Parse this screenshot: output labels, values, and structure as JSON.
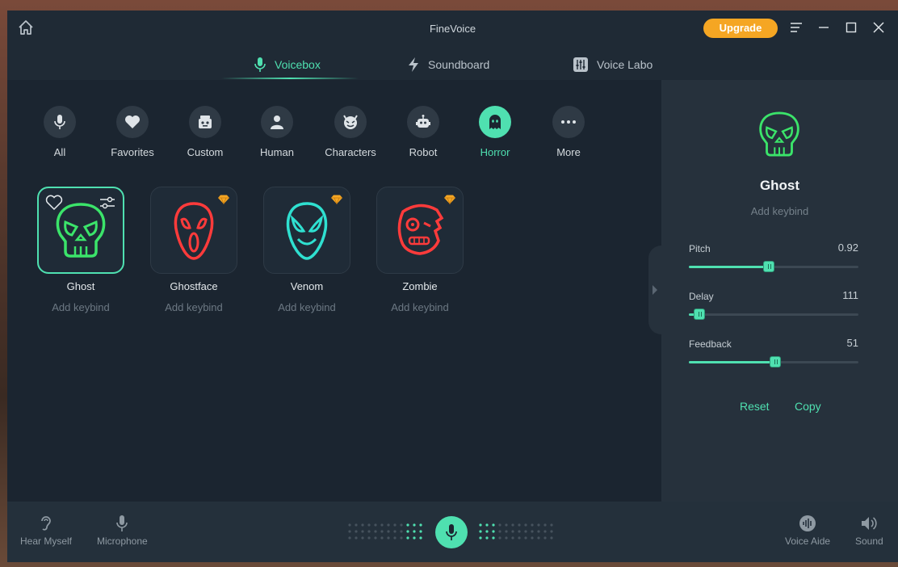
{
  "app": {
    "title": "FineVoice",
    "upgrade_label": "Upgrade"
  },
  "tabs": [
    {
      "label": "Voicebox",
      "icon": "microphone-icon",
      "active": true
    },
    {
      "label": "Soundboard",
      "icon": "lightning-icon",
      "active": false
    },
    {
      "label": "Voice Labo",
      "icon": "mixer-icon",
      "active": false
    }
  ],
  "categories": [
    {
      "label": "All",
      "icon": "microphone-icon"
    },
    {
      "label": "Favorites",
      "icon": "heart-icon"
    },
    {
      "label": "Custom",
      "icon": "custom-voice-icon"
    },
    {
      "label": "Human",
      "icon": "person-icon"
    },
    {
      "label": "Characters",
      "icon": "devil-icon"
    },
    {
      "label": "Robot",
      "icon": "robot-icon"
    },
    {
      "label": "Horror",
      "icon": "ghost-icon",
      "active": true
    },
    {
      "label": "More",
      "icon": "more-dots-icon"
    }
  ],
  "voices": [
    {
      "name": "Ghost",
      "keybind": "Add keybind",
      "selected": true,
      "premium": false,
      "color": "#3be46a"
    },
    {
      "name": "Ghostface",
      "keybind": "Add keybind",
      "premium": true,
      "color": "#ff3b3b"
    },
    {
      "name": "Venom",
      "keybind": "Add keybind",
      "premium": true,
      "color": "#2fe0d0"
    },
    {
      "name": "Zombie",
      "keybind": "Add keybind",
      "premium": true,
      "color": "#ff3b3b"
    }
  ],
  "side": {
    "voice_name": "Ghost",
    "keybind": "Add keybind",
    "sliders": [
      {
        "label": "Pitch",
        "value": "0.92",
        "fill": 0.47
      },
      {
        "label": "Delay",
        "value": "111",
        "fill": 0.06
      },
      {
        "label": "Feedback",
        "value": "51",
        "fill": 0.51
      }
    ],
    "reset_label": "Reset",
    "copy_label": "Copy"
  },
  "bottom": {
    "hear_myself": "Hear Myself",
    "microphone": "Microphone",
    "voice_aide": "Voice Aide",
    "sound": "Sound"
  },
  "colors": {
    "accent": "#4fe0b0",
    "upgrade": "#f5a623",
    "premium_gem": "#f5a623"
  }
}
